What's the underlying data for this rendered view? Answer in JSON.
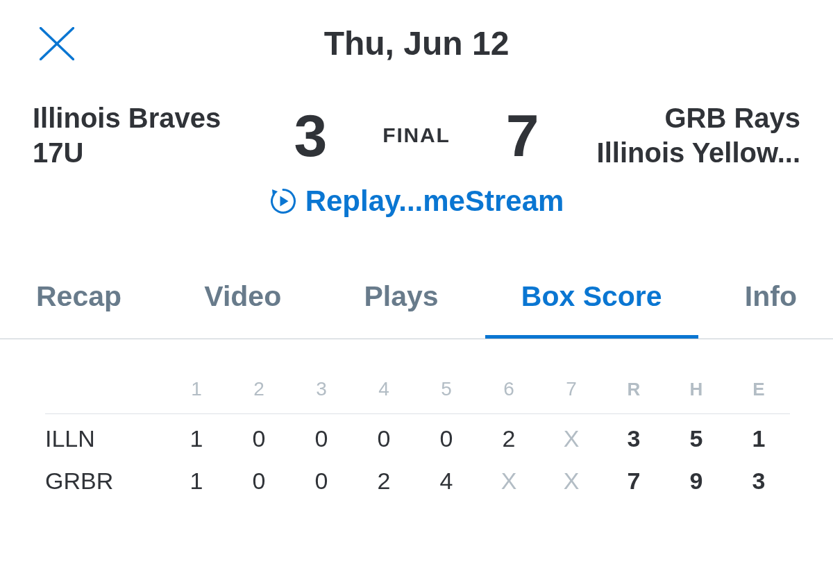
{
  "header": {
    "title": "Thu, Jun 12"
  },
  "game": {
    "teams": [
      {
        "name_lines": [
          "Illinois Braves",
          "17U"
        ],
        "score": "3"
      },
      {
        "name_lines": [
          "GRB Rays",
          "Illinois Yellow..."
        ],
        "score": "7"
      }
    ],
    "status": "FINAL"
  },
  "replay_link": {
    "label": "Replay...meStream"
  },
  "tabs": [
    {
      "label": "Recap",
      "selected": false
    },
    {
      "label": "Video",
      "selected": false
    },
    {
      "label": "Plays",
      "selected": false
    },
    {
      "label": "Box Score",
      "selected": true
    },
    {
      "label": "Info",
      "selected": false
    }
  ],
  "box_score": {
    "columns": [
      {
        "label": "1",
        "kind": "inning"
      },
      {
        "label": "2",
        "kind": "inning"
      },
      {
        "label": "3",
        "kind": "inning"
      },
      {
        "label": "4",
        "kind": "inning"
      },
      {
        "label": "5",
        "kind": "inning"
      },
      {
        "label": "6",
        "kind": "inning"
      },
      {
        "label": "7",
        "kind": "inning"
      },
      {
        "label": "R",
        "kind": "total"
      },
      {
        "label": "H",
        "kind": "total"
      },
      {
        "label": "E",
        "kind": "total"
      }
    ],
    "rows": [
      {
        "team": "ILLN",
        "cells": [
          {
            "value": "1",
            "kind": "inning"
          },
          {
            "value": "0",
            "kind": "inning"
          },
          {
            "value": "0",
            "kind": "inning"
          },
          {
            "value": "0",
            "kind": "inning"
          },
          {
            "value": "0",
            "kind": "inning"
          },
          {
            "value": "2",
            "kind": "inning"
          },
          {
            "value": "X",
            "kind": "unplayed"
          },
          {
            "value": "3",
            "kind": "total"
          },
          {
            "value": "5",
            "kind": "total"
          },
          {
            "value": "1",
            "kind": "total"
          }
        ]
      },
      {
        "team": "GRBR",
        "cells": [
          {
            "value": "1",
            "kind": "inning"
          },
          {
            "value": "0",
            "kind": "inning"
          },
          {
            "value": "0",
            "kind": "inning"
          },
          {
            "value": "2",
            "kind": "inning"
          },
          {
            "value": "4",
            "kind": "inning"
          },
          {
            "value": "X",
            "kind": "unplayed"
          },
          {
            "value": "X",
            "kind": "unplayed"
          },
          {
            "value": "7",
            "kind": "total"
          },
          {
            "value": "9",
            "kind": "total"
          },
          {
            "value": "3",
            "kind": "total"
          }
        ]
      }
    ]
  }
}
